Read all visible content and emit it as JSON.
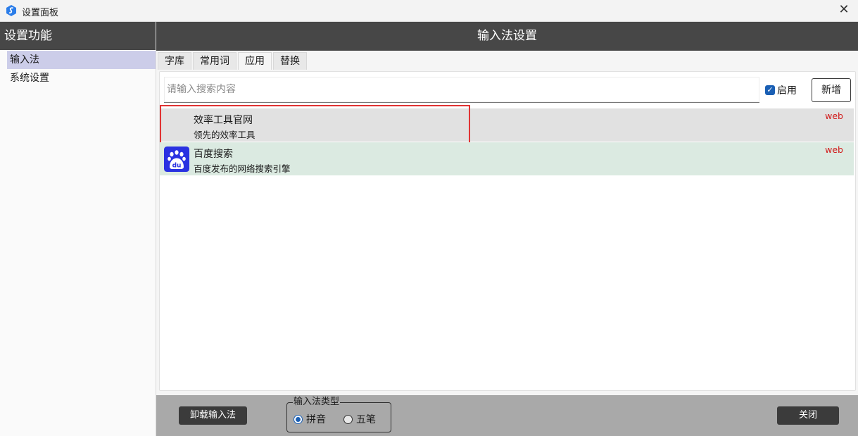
{
  "window": {
    "title": "设置面板",
    "close_glyph": "✕"
  },
  "sidebar": {
    "header": "设置功能",
    "items": [
      {
        "label": "输入法"
      },
      {
        "label": "系统设置"
      }
    ]
  },
  "main": {
    "header": "输入法设置",
    "tabs": [
      {
        "label": "字库"
      },
      {
        "label": "常用词"
      },
      {
        "label": "应用"
      },
      {
        "label": "替换"
      }
    ],
    "active_tab": "应用",
    "search": {
      "placeholder": "请输入搜索内容",
      "value": ""
    },
    "enable_checkbox": {
      "label": "启用",
      "checked": true
    },
    "add_button": "新增",
    "items": [
      {
        "name": "效率工具官网",
        "desc": "领先的效率工具",
        "tag": "web",
        "icon": "blank-icon"
      },
      {
        "name": "百度搜索",
        "desc": "百度发布的网络搜索引擎",
        "tag": "web",
        "icon": "baidu-logo-icon"
      }
    ]
  },
  "bottom": {
    "uninstall_button": "卸载输入法",
    "type_group": {
      "legend": "输入法类型",
      "options": [
        {
          "label": "拼音",
          "selected": true
        },
        {
          "label": "五笔",
          "selected": false
        }
      ]
    },
    "close_button": "关闭"
  },
  "colors": {
    "header_bg": "#474747",
    "accent": "#1a5fb4",
    "tag": "#d11a1a",
    "highlight": "#e03434"
  }
}
